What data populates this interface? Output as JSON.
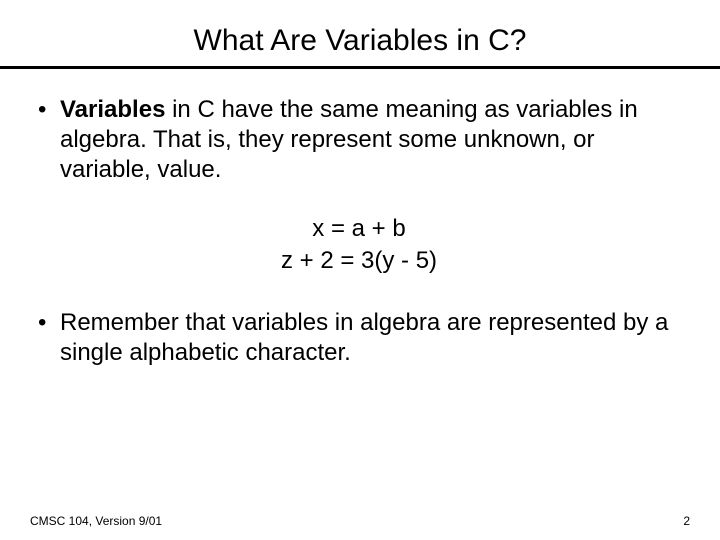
{
  "title": "What Are Variables in C?",
  "bullets": [
    {
      "pre_bold": "Variables",
      "rest": " in C have the same meaning as variables in algebra.  That is, they represent some unknown, or variable, value."
    },
    {
      "text": "Remember that variables in algebra are represented by a single alphabetic character."
    }
  ],
  "equations": {
    "line1": "x = a + b",
    "line2": "z + 2 = 3(y - 5)"
  },
  "footer": {
    "left": "CMSC 104, Version 9/01",
    "right": "2"
  }
}
